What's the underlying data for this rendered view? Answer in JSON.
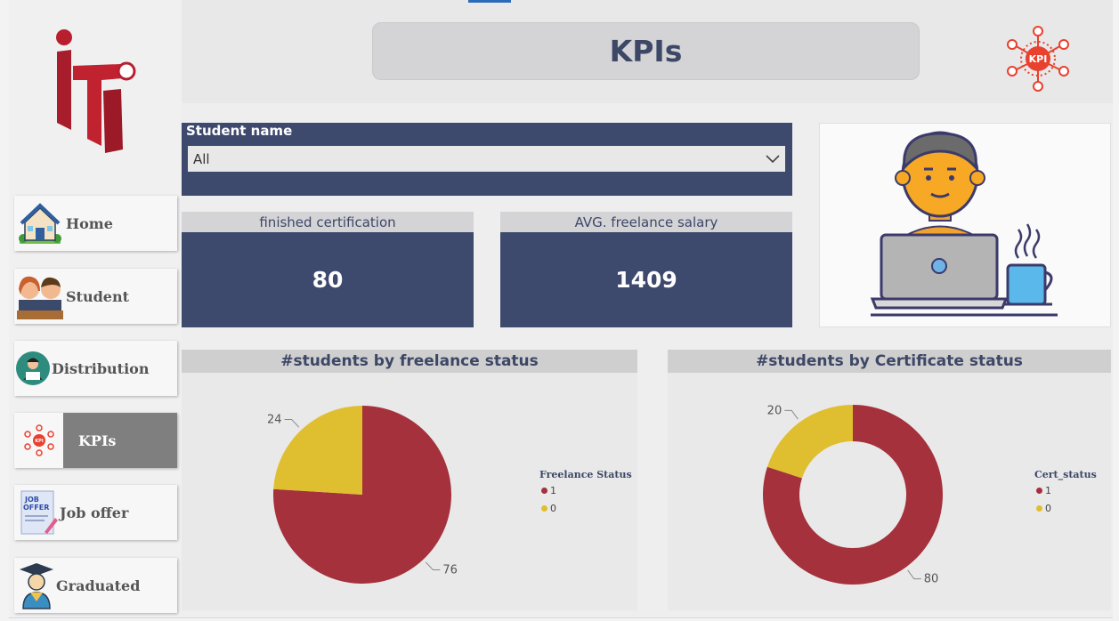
{
  "header": {
    "title": "KPIs"
  },
  "sidebar": {
    "items": [
      {
        "label": "Home",
        "icon": "house-icon"
      },
      {
        "label": "Student",
        "icon": "students-icon"
      },
      {
        "label": "Distribution",
        "icon": "student-reading-icon"
      },
      {
        "label": "KPIs",
        "icon": "kpi-icon",
        "active": true
      },
      {
        "label": "Job offer",
        "icon": "job-offer-icon"
      },
      {
        "label": "Graduated",
        "icon": "graduate-icon"
      }
    ]
  },
  "slicer": {
    "title": "Student name",
    "value": "All"
  },
  "cards": [
    {
      "label": "finished certification",
      "value": "80"
    },
    {
      "label": "AVG. freelance salary",
      "value": "1409"
    }
  ],
  "colors": {
    "navy": "#3e4a6d",
    "red": "#a4313c",
    "yellow": "#dfbf2f",
    "active_nav": "#7f7f7f"
  },
  "chart_data": [
    {
      "type": "pie",
      "title": "#students by freelance status",
      "legend_title": "Freelance Status",
      "legend_position": "right",
      "categories": [
        "1",
        "0"
      ],
      "values": [
        76,
        24
      ],
      "data_labels": [
        "76",
        "24"
      ],
      "colors": [
        "#a4313c",
        "#dfbf2f"
      ]
    },
    {
      "type": "donut",
      "title": "#students by Certificate status",
      "legend_title": "Cert_status",
      "legend_position": "right",
      "categories": [
        "1",
        "0"
      ],
      "values": [
        80,
        20
      ],
      "data_labels": [
        "80",
        "20"
      ],
      "colors": [
        "#a4313c",
        "#dfbf2f"
      ]
    }
  ]
}
